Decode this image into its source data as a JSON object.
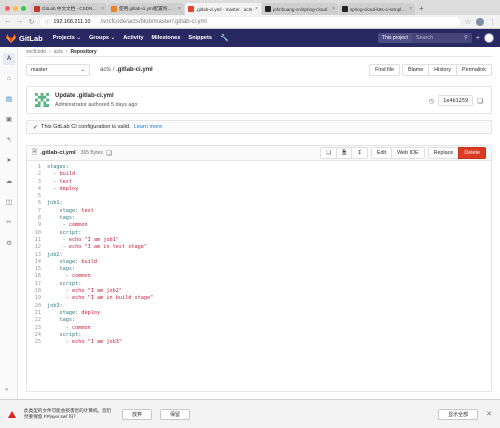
{
  "browser": {
    "tabs": [
      {
        "title": "GitLab 中文文档 - CSDN博客",
        "favicon_color": "#c0392b"
      },
      {
        "title": "使用.gitlab-ci.yml配置构建过程",
        "favicon_color": "#e8832a"
      },
      {
        "title": ".gitlab-ci.yml · master · acts",
        "favicon_color": "#e24329",
        "active": true
      },
      {
        "title": "johnhuang-cn/spring-cloud",
        "favicon_color": "#222222"
      },
      {
        "title": "spring-cloud-k8s-ci-template",
        "favicon_color": "#222222"
      }
    ],
    "url_host": "192.168.211.10",
    "url_path": "/sncfcode/acts/blob/master/.gitlab-ci.yml"
  },
  "header": {
    "brand": "GitLab",
    "nav": [
      "Projects ⌄",
      "Groups ⌄",
      "Activity",
      "Milestones",
      "Snippets"
    ],
    "scope": "This project",
    "search_placeholder": "Search"
  },
  "sidebar": {
    "project_initial": "A",
    "collapse_label": "«"
  },
  "breadcrumb": [
    "sncfcode",
    "acts",
    "Repository"
  ],
  "filebar": {
    "branch": "master",
    "path_root": "acts",
    "path_sep": "/",
    "path_file": ".gitlab-ci.yml",
    "find_file": "Find file",
    "blame": "Blame",
    "history": "History",
    "permalink": "Permalink"
  },
  "commit": {
    "title": "Update .gitlab-ci.yml",
    "meta": "Administrator authored 5 days ago",
    "sha": "1e4b1259"
  },
  "ci_notice": {
    "text": "This GitLab CI configuration is valid.",
    "link": "Learn more"
  },
  "file": {
    "name": ".gitlab-ci.yml",
    "size": "365 Bytes",
    "edit": "Edit",
    "web_ide": "Web IDE",
    "replace": "Replace",
    "delete": "Delete",
    "lines": [
      {
        "n": "1",
        "key": "stages",
        "ind": "",
        "kind": "key"
      },
      {
        "n": "2",
        "ind": "  ",
        "val": "build",
        "kind": "item"
      },
      {
        "n": "3",
        "ind": "  ",
        "val": "test",
        "kind": "item"
      },
      {
        "n": "4",
        "ind": "  ",
        "val": "deploy",
        "kind": "item"
      },
      {
        "n": "5",
        "kind": "blank"
      },
      {
        "n": "6",
        "key": "job1",
        "ind": "",
        "kind": "key"
      },
      {
        "n": "7",
        "key": "stage",
        "ind": "    ",
        "val": "test",
        "kind": "kv"
      },
      {
        "n": "8",
        "key": "tags",
        "ind": "    ",
        "kind": "key"
      },
      {
        "n": "9",
        "ind": "     ",
        "val": "common",
        "kind": "item"
      },
      {
        "n": "10",
        "key": "script",
        "ind": "    ",
        "kind": "key"
      },
      {
        "n": "11",
        "ind": "     ",
        "val": "echo \"I am job1\"",
        "kind": "item"
      },
      {
        "n": "12",
        "ind": "     ",
        "val": "echo \"I am in test stage\"",
        "kind": "item"
      },
      {
        "n": "13",
        "key": "job2",
        "ind": "",
        "kind": "key"
      },
      {
        "n": "14",
        "key": "stage",
        "ind": "    ",
        "val": "build",
        "kind": "kv"
      },
      {
        "n": "15",
        "key": "tags",
        "ind": "    ",
        "kind": "key"
      },
      {
        "n": "16",
        "ind": "      ",
        "val": "common",
        "kind": "item"
      },
      {
        "n": "17",
        "key": "script",
        "ind": "    ",
        "kind": "key"
      },
      {
        "n": "18",
        "ind": "      ",
        "val": "echo \"I am job2\"",
        "kind": "item"
      },
      {
        "n": "19",
        "ind": "      ",
        "val": "echo \"I am in build stage\"",
        "kind": "item"
      },
      {
        "n": "20",
        "key": "job3",
        "ind": "",
        "kind": "key"
      },
      {
        "n": "21",
        "key": "stage",
        "ind": "    ",
        "val": "deploy",
        "kind": "kv"
      },
      {
        "n": "22",
        "key": "tags",
        "ind": "    ",
        "kind": "key"
      },
      {
        "n": "23",
        "ind": "      ",
        "val": "common",
        "kind": "item"
      },
      {
        "n": "24",
        "key": "script",
        "ind": "    ",
        "kind": "key"
      },
      {
        "n": "25",
        "ind": "      ",
        "val": "echo \"I am job3\"",
        "kind": "item"
      }
    ]
  },
  "download_bar": {
    "text": "此类型的文件可能会损害您的计算机。您仍然要保留 FPlayer.swf 吗？",
    "discard": "放弃",
    "keep": "保留",
    "show_all": "显示全部"
  }
}
